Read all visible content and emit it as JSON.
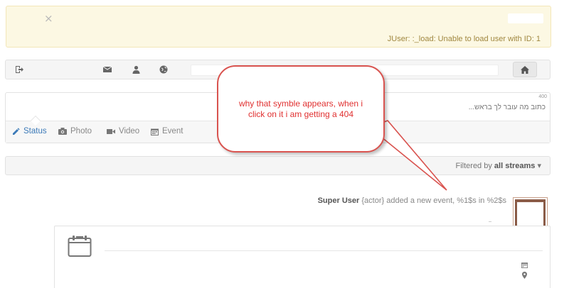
{
  "alert": {
    "close_glyph": "×",
    "message": "JUser: :_load: Unable to load user with ID: 1"
  },
  "toolbar": {
    "icons": [
      "logout-icon",
      "envelope-icon",
      "user-icon",
      "globe-icon",
      "home-icon"
    ]
  },
  "composer": {
    "counter": "400",
    "placeholder": "כתוב מה עובר לך בראש...",
    "tabs": [
      {
        "label": "Status",
        "icon": "pencil-icon"
      },
      {
        "label": "Photo",
        "icon": "camera-icon"
      },
      {
        "label": "Video",
        "icon": "video-icon"
      },
      {
        "label": "Event",
        "icon": "calendar-icon"
      }
    ]
  },
  "filter": {
    "prefix": "Filtered by",
    "value": "all streams",
    "caret": "▾"
  },
  "activity": {
    "actor": "Super User",
    "text": " {actor} added a new event, %1$s in %2$s"
  },
  "annotation": {
    "text": "why that symble appears, when i click on it i am getting a 404"
  },
  "colors": {
    "alert_bg": "#fcf8e3",
    "accent": "#3c7ab8",
    "annotation": "#d9534f"
  }
}
